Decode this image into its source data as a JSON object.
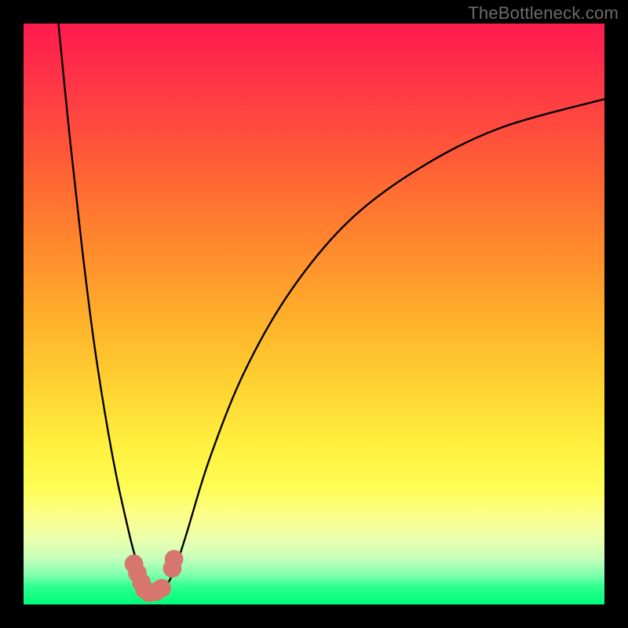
{
  "watermark": "TheBottleneck.com",
  "chart_data": {
    "type": "line",
    "title": "",
    "xlabel": "",
    "ylabel": "",
    "xlim": [
      0,
      100
    ],
    "ylim": [
      0,
      100
    ],
    "grid": false,
    "legend": false,
    "gradient_stops": [
      {
        "pct": 0,
        "color": "#ff1a4f"
      },
      {
        "pct": 6,
        "color": "#ff2a4a"
      },
      {
        "pct": 18,
        "color": "#ff4b3e"
      },
      {
        "pct": 28,
        "color": "#ff6a32"
      },
      {
        "pct": 40,
        "color": "#ff8e2c"
      },
      {
        "pct": 52,
        "color": "#ffb42b"
      },
      {
        "pct": 64,
        "color": "#ffd733"
      },
      {
        "pct": 73,
        "color": "#fff13f"
      },
      {
        "pct": 80,
        "color": "#fffd55"
      },
      {
        "pct": 85,
        "color": "#fbff8e"
      },
      {
        "pct": 89,
        "color": "#e9ffae"
      },
      {
        "pct": 92,
        "color": "#c7ffba"
      },
      {
        "pct": 95,
        "color": "#7dffad"
      },
      {
        "pct": 97,
        "color": "#2bff8f"
      },
      {
        "pct": 100,
        "color": "#00ff7a"
      }
    ],
    "series": [
      {
        "name": "left-curve",
        "x": [
          6,
          8,
          10,
          12,
          14,
          16,
          18,
          19,
          20,
          21,
          22
        ],
        "y": [
          100,
          80,
          62,
          46,
          33,
          22,
          13,
          9,
          6,
          4,
          2
        ]
      },
      {
        "name": "right-curve",
        "x": [
          24,
          26,
          28,
          32,
          38,
          46,
          56,
          68,
          82,
          100
        ],
        "y": [
          2,
          6,
          12,
          25,
          40,
          54,
          66,
          75,
          82,
          87
        ]
      }
    ],
    "markers": [
      {
        "name": "left-marker-1",
        "x": 19.0,
        "y": 7.0,
        "r": 1.6,
        "color": "#d6766e"
      },
      {
        "name": "left-marker-2",
        "x": 19.6,
        "y": 5.4,
        "r": 1.6,
        "color": "#d6766e"
      },
      {
        "name": "left-marker-3",
        "x": 20.3,
        "y": 3.8,
        "r": 1.6,
        "color": "#d6766e"
      },
      {
        "name": "left-marker-4",
        "x": 20.8,
        "y": 2.6,
        "r": 1.6,
        "color": "#d6766e"
      },
      {
        "name": "left-marker-5",
        "x": 21.6,
        "y": 2.0,
        "r": 1.6,
        "color": "#d6766e"
      },
      {
        "name": "left-marker-6",
        "x": 22.8,
        "y": 2.2,
        "r": 1.6,
        "color": "#d6766e"
      },
      {
        "name": "left-marker-7",
        "x": 23.8,
        "y": 2.8,
        "r": 1.6,
        "color": "#d6766e"
      },
      {
        "name": "right-marker-1",
        "x": 25.6,
        "y": 6.2,
        "r": 1.6,
        "color": "#d6766e"
      },
      {
        "name": "right-marker-2",
        "x": 25.9,
        "y": 7.8,
        "r": 1.6,
        "color": "#d6766e"
      }
    ],
    "curve_stroke": "#000000",
    "curve_stroke_width": 2.4
  }
}
